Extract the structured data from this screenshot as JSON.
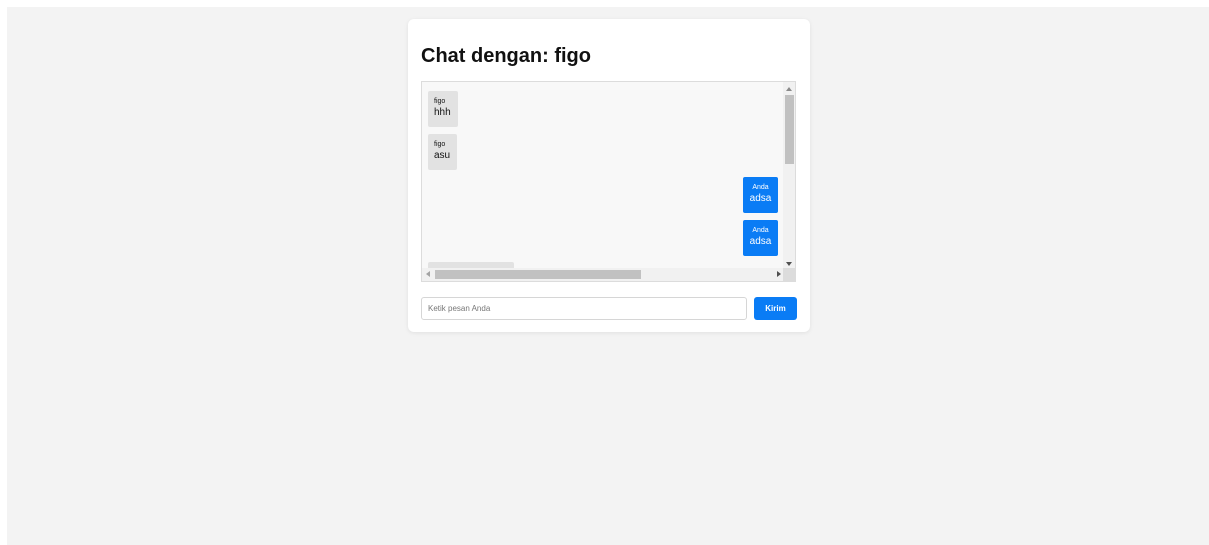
{
  "chat": {
    "title": "Chat dengan: figo",
    "messages": [
      {
        "sender": "figo",
        "text": "hhh",
        "mine": false
      },
      {
        "sender": "figo",
        "text": "asu",
        "mine": false
      },
      {
        "sender": "Anda",
        "text": "adsa",
        "mine": true
      },
      {
        "sender": "Anda",
        "text": "adsa",
        "mine": true
      }
    ]
  },
  "composer": {
    "placeholder": "Ketik pesan Anda",
    "value": "",
    "send_label": "Kirim"
  },
  "colors": {
    "accent": "#0a7cf5",
    "other_bubble": "#e2e2e2",
    "page_bg": "#f3f3f3"
  }
}
